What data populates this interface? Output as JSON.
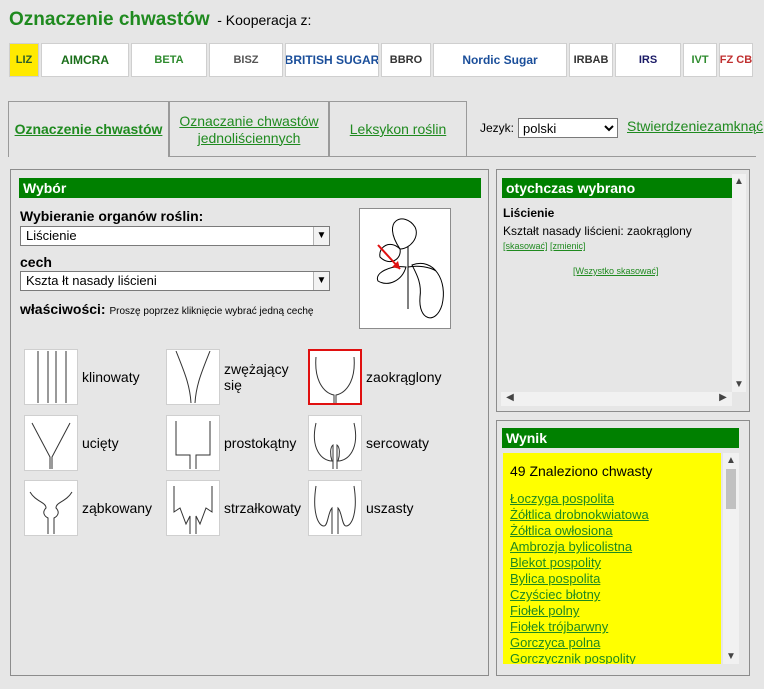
{
  "header": {
    "title": "Oznaczenie chwastów",
    "subtitle": "- Kooperacja z:"
  },
  "logos": [
    {
      "name": "liz",
      "text": "LIZ",
      "bg": "#ffea00",
      "color": "#2a5c2a",
      "width": 30
    },
    {
      "name": "aimcra",
      "text": "AIMCRA",
      "bg": "#ffffff",
      "color": "#1a6e1a",
      "width": 88
    },
    {
      "name": "beta",
      "text": "BETA",
      "bg": "#ffffff",
      "color": "#2e8b2e",
      "width": 76
    },
    {
      "name": "bisz",
      "text": "BISZ",
      "bg": "#ffffff",
      "color": "#555555",
      "width": 74
    },
    {
      "name": "british-sugar",
      "text": "BRITISH SUGAR",
      "bg": "#ffffff",
      "color": "#1a4e9a",
      "width": 94
    },
    {
      "name": "bbro",
      "text": "BBRO",
      "bg": "#ffffff",
      "color": "#333333",
      "width": 50
    },
    {
      "name": "nordic-sugar",
      "text": "Nordic Sugar",
      "bg": "#ffffff",
      "color": "#1a4e9a",
      "width": 134
    },
    {
      "name": "irbab",
      "text": "IRBAB",
      "bg": "#ffffff",
      "color": "#333333",
      "width": 44
    },
    {
      "name": "irs",
      "text": "IRS",
      "bg": "#ffffff",
      "color": "#1a1a66",
      "width": 66
    },
    {
      "name": "ivt",
      "text": "IVT",
      "bg": "#ffffff",
      "color": "#2e8b2e",
      "width": 34
    },
    {
      "name": "sfz",
      "text": "SFZ CBS",
      "bg": "#ffffff",
      "color": "#c03030",
      "width": 34
    }
  ],
  "tabs": [
    {
      "label": "Oznaczenie chwastów",
      "active": true
    },
    {
      "label": "Oznaczanie chwastów jednoliściennych",
      "active": false
    },
    {
      "label": "Leksykon roślin",
      "active": false
    }
  ],
  "language": {
    "label": "Jezyk:",
    "value": "polski"
  },
  "confirm_label": "Stwierdzenie",
  "close_label": "zamknąć",
  "selection": {
    "header": "Wybór",
    "organ_label": "Wybieranie organów roślin:",
    "organ_value": "Liścienie",
    "feature_label": "cech",
    "feature_value": "Kszta łt nasady liścieni",
    "properties_label": "właściwości:",
    "properties_hint": "Proszę poprzez kliknięcie wybrać jedną cechę",
    "options": [
      {
        "label": "klinowaty"
      },
      {
        "label": "zwężający się"
      },
      {
        "label": "zaokrąglony",
        "selected": true
      },
      {
        "label": "ucięty"
      },
      {
        "label": "prostokątny"
      },
      {
        "label": "sercowaty"
      },
      {
        "label": "ząbkowany"
      },
      {
        "label": "strzałkowaty"
      },
      {
        "label": "uszasty"
      }
    ]
  },
  "chosen": {
    "header": "otychczas wybrano",
    "organ": "Liścienie",
    "feature_line": "Kształt nasady liścieni: zaokrąglony",
    "cancel_link": "[skasować]",
    "change_link": "[zmienic]",
    "cancel_all_link": "[Wszystko skasować]"
  },
  "result": {
    "header": "Wynik",
    "count_text": "49 Znaleziono chwasty",
    "items": [
      "Łoczyga pospolita",
      "Żółtlica drobnokwiatowa",
      "Żółtlica owłosiona",
      "Ambrozja bylicolistna",
      "Blekot pospolity",
      "Bylica pospolita",
      "Czyściec błotny",
      "Fiołek polny",
      "Fiołek trójbarwny",
      "Gorczyca polna",
      "Gorczycznik pospolity"
    ]
  },
  "colors": {
    "accent_green": "#008000",
    "link_green": "#1f8a1f",
    "result_bg": "#ffff00",
    "selected_border": "#e01010"
  }
}
